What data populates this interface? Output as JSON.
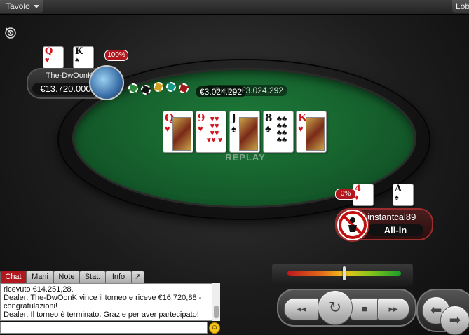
{
  "topbar": {
    "table_menu": "Tavolo",
    "lobby": "Lobby"
  },
  "players": [
    {
      "name": "The-DwOonK",
      "stack": "€13.720.000",
      "win_pct": "100%",
      "hole_cards": [
        {
          "rank": "Q",
          "suit": "♥",
          "color": "red"
        },
        {
          "rank": "K",
          "suit": "♠",
          "color": "blk"
        }
      ]
    },
    {
      "name": "instantcal89",
      "status": "All-in",
      "win_pct": "0%",
      "hole_cards": [
        {
          "rank": "4",
          "suit": "♦",
          "color": "red"
        },
        {
          "rank": "A",
          "suit": "♠",
          "color": "blk"
        }
      ]
    }
  ],
  "pot": {
    "bet_amount": "€3.024.292",
    "label": "Piatto: €3.024.292"
  },
  "board": [
    {
      "rank": "Q",
      "suit": "♥",
      "color": "red"
    },
    {
      "rank": "9",
      "suit": "♥",
      "color": "red"
    },
    {
      "rank": "J",
      "suit": "♠",
      "color": "blk"
    },
    {
      "rank": "8",
      "suit": "♣",
      "color": "blk"
    },
    {
      "rank": "K",
      "suit": "♥",
      "color": "red"
    }
  ],
  "table_label": "REPLAY",
  "chat": {
    "tabs": [
      "Chat",
      "Mani",
      "Note",
      "Stat.",
      "Info",
      "↗"
    ],
    "active_tab": "Chat",
    "lines": [
      "ricevuto €14.251,28.",
      "Dealer: The-DwOonK vince il torneo e riceve €16.720,88 - congratulazioni!",
      "Dealer: Il torneo è terminato. Grazie per aver partecipato!"
    ],
    "input_value": ""
  },
  "replay_controls": {
    "speed_level": 0.5,
    "rewind": "◂◂",
    "replay": "↻",
    "stop": "■",
    "fast_forward": "▸▸",
    "prev": "⬅",
    "next": "➡"
  },
  "colors": {
    "felt": "#155f2c",
    "accent_red": "#b0181e"
  }
}
